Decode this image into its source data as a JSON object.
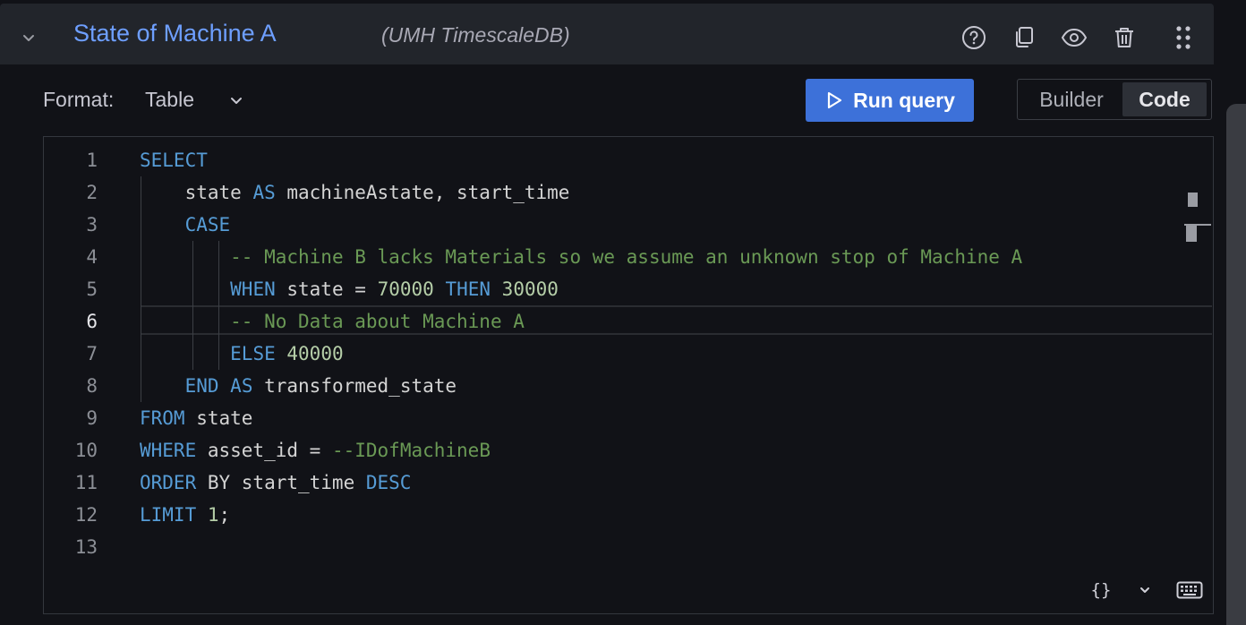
{
  "header": {
    "query_name": "State of Machine A",
    "datasource": "(UMH TimescaleDB)",
    "icons": [
      "chevron-down-icon",
      "help-icon",
      "duplicate-icon",
      "eye-icon",
      "trash-icon",
      "drag-handle-icon"
    ]
  },
  "toolbar": {
    "format_label": "Format:",
    "format_value": "Table",
    "run_label": "Run query",
    "builder_label": "Builder",
    "code_label": "Code",
    "mode_selected": "Code"
  },
  "editor": {
    "active_line": 6,
    "lines": [
      {
        "num": "1",
        "text": "SELECT"
      },
      {
        "num": "2",
        "text": "    state AS machineAstate, start_time"
      },
      {
        "num": "3",
        "text": "    CASE"
      },
      {
        "num": "4",
        "text": "        -- Machine B lacks Materials so we assume an unknown stop of Machine A"
      },
      {
        "num": "5",
        "text": "        WHEN state = 70000 THEN 30000"
      },
      {
        "num": "6",
        "text": "        -- No Data about Machine A"
      },
      {
        "num": "7",
        "text": "        ELSE 40000"
      },
      {
        "num": "8",
        "text": "    END AS transformed_state"
      },
      {
        "num": "9",
        "text": "FROM state"
      },
      {
        "num": "10",
        "text": "WHERE asset_id = --IDofMachineB"
      },
      {
        "num": "11",
        "text": "ORDER BY start_time DESC"
      },
      {
        "num": "12",
        "text": "LIMIT 1;"
      },
      {
        "num": "13",
        "text": ""
      }
    ]
  },
  "footer": {
    "format_code_label": "{}"
  },
  "colors": {
    "accent": "#3d71d9",
    "title": "#6e9fff",
    "keyword": "#569cd6",
    "number": "#b5cea8",
    "comment": "#6a9955"
  }
}
